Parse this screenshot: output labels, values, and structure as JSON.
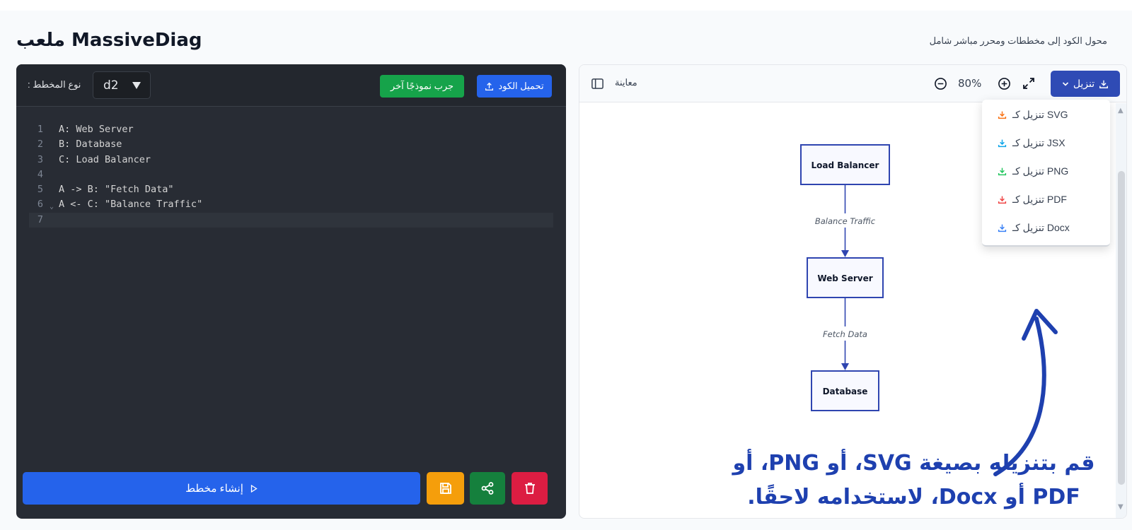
{
  "header": {
    "brand": "MassiveDiag ملعب",
    "tagline": "محول الكود إلى مخططات ومحرر مباشر شامل"
  },
  "editor": {
    "upload_label": "تحميل الكود",
    "sample_label": "جرب نموذجًا آخر",
    "diagram_type_value": "d2",
    "diagram_type_label": ": نوع المخطط",
    "code_lines": [
      {
        "num": "1",
        "text": "A: Web Server"
      },
      {
        "num": "2",
        "text": "B: Database"
      },
      {
        "num": "3",
        "text": "C: Load Balancer"
      },
      {
        "num": "4",
        "text": ""
      },
      {
        "num": "5",
        "text": "A -> B: \"Fetch Data\""
      },
      {
        "num": "6",
        "text": "A <- C: \"Balance Traffic\""
      },
      {
        "num": "7",
        "text": ""
      }
    ],
    "generate_label": "إنشاء مخطط"
  },
  "preview": {
    "label": "معاينة",
    "zoom": "80%",
    "download_label": "تنزيل",
    "download_options": [
      {
        "label": "تنزيل كـ SVG",
        "color": "#f97316"
      },
      {
        "label": "تنزيل كـ JSX",
        "color": "#0ea5e9"
      },
      {
        "label": "تنزيل كـ PNG",
        "color": "#22c55e"
      },
      {
        "label": "تنزيل كـ PDF",
        "color": "#ef4444"
      },
      {
        "label": "تنزيل كـ Docx",
        "color": "#3b82f6"
      }
    ],
    "diagram": {
      "nodes": {
        "load_balancer": "Load Balancer",
        "web_server": "Web Server",
        "database": "Database"
      },
      "edges": {
        "balance": "Balance Traffic",
        "fetch": "Fetch Data"
      }
    },
    "annotation_line1": "قم بتنزيله بصيغة SVG، أو PNG، أو",
    "annotation_line2": "PDF أو Docx، لاستخدامه لاحقًا."
  },
  "colors": {
    "accent_blue": "#2563eb",
    "green": "#16a34a",
    "amber": "#f59e0b",
    "red": "#dc1d42",
    "diagram_stroke": "#2f45b0"
  }
}
